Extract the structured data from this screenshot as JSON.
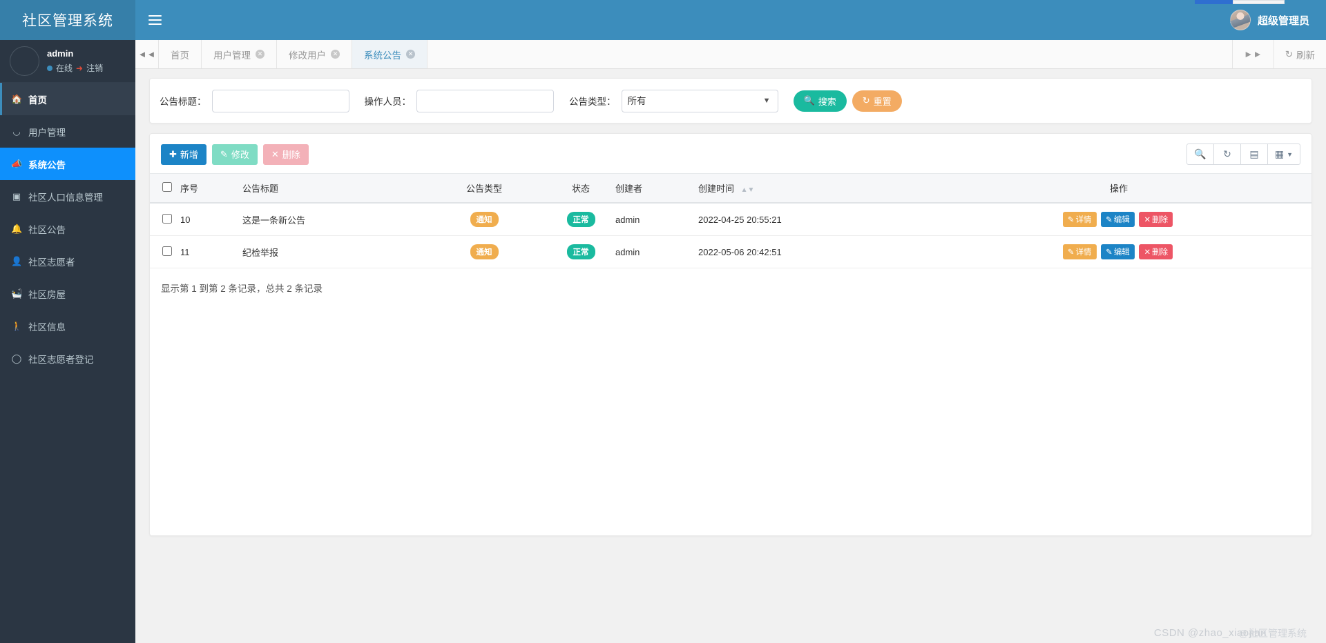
{
  "app": {
    "brand": "社区管理系统",
    "menu_icon": "hamburger-icon",
    "admin_label": "超级管理员"
  },
  "sidebar": {
    "user": {
      "name": "admin",
      "status": "在线",
      "logout": "注销",
      "status_dot_color": "#3c8dbc",
      "logout_icon_color": "#dd4b39"
    },
    "items": [
      {
        "label": "首页",
        "icon": "home-icon",
        "state": "active-home"
      },
      {
        "label": "用户管理",
        "icon": "user-icon",
        "state": ""
      },
      {
        "label": "系统公告",
        "icon": "bullhorn-icon",
        "state": "active"
      },
      {
        "label": "社区人口信息管理",
        "icon": "id-card-icon",
        "state": ""
      },
      {
        "label": "社区公告",
        "icon": "bell-icon",
        "state": ""
      },
      {
        "label": "社区志愿者",
        "icon": "user-solid-icon",
        "state": ""
      },
      {
        "label": "社区房屋",
        "icon": "bath-icon",
        "state": ""
      },
      {
        "label": "社区信息",
        "icon": "walking-icon",
        "state": ""
      },
      {
        "label": "社区志愿者登记",
        "icon": "circle-icon",
        "state": ""
      }
    ]
  },
  "tabstrip": {
    "scroll_left_icon": "double-chevron-left-icon",
    "scroll_right_icon": "double-chevron-right-icon",
    "refresh_label": "刷新",
    "refresh_icon": "refresh-icon",
    "tabs": [
      {
        "label": "首页",
        "closable": false,
        "active": false
      },
      {
        "label": "用户管理",
        "closable": true,
        "active": false
      },
      {
        "label": "修改用户",
        "closable": true,
        "active": false
      },
      {
        "label": "系统公告",
        "closable": true,
        "active": true
      }
    ]
  },
  "filter": {
    "title_label": "公告标题：",
    "title_value": "",
    "title_placeholder": "",
    "operator_label": "操作人员：",
    "operator_value": "",
    "operator_placeholder": "",
    "type_label": "公告类型：",
    "type_selected": "所有",
    "type_options": [
      "所有"
    ],
    "search_label": "搜索",
    "search_icon": "search-icon",
    "reset_label": "重置",
    "reset_icon": "refresh-icon",
    "search_color": "#1aba9f",
    "reset_color": "#f3ab63"
  },
  "toolbar": {
    "add_label": "新增",
    "add_icon": "plus-icon",
    "edit_label": "修改",
    "edit_icon": "pencil-square-icon",
    "delete_label": "删除",
    "delete_icon": "times-icon",
    "right_icons": [
      "search-icon",
      "refresh-icon",
      "list-view-icon",
      "columns-grid-icon"
    ]
  },
  "table": {
    "columns": [
      "序号",
      "公告标题",
      "公告类型",
      "状态",
      "创建者",
      "创建时间",
      "操作"
    ],
    "sort_icon": "sort-updown-icon",
    "rows": [
      {
        "seq": "10",
        "title": "这是一条新公告",
        "type": "通知",
        "state": "正常",
        "creator": "admin",
        "created_at": "2022-04-25 20:55:21",
        "ops": [
          "详情",
          "编辑",
          "删除"
        ]
      },
      {
        "seq": "11",
        "title": "纪检举报",
        "type": "通知",
        "state": "正常",
        "creator": "admin",
        "created_at": "2022-05-06 20:42:51",
        "ops": [
          "详情",
          "编辑",
          "删除"
        ]
      }
    ],
    "op_labels": {
      "detail": "详情",
      "edit": "编辑",
      "delete": "删除"
    },
    "badge_type_color": "#f0ad4e",
    "badge_state_color": "#1aba9f"
  },
  "pagination": {
    "info": "显示第 1 到第 2 条记录，总共 2 条记录"
  },
  "watermark": {
    "csdn": "CSDN @zhao_xiaojian",
    "system": "@社区管理系统"
  }
}
